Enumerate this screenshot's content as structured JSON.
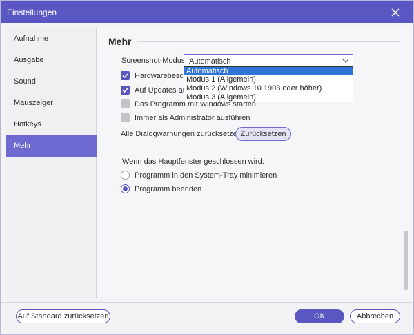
{
  "window": {
    "title": "Einstellungen"
  },
  "sidebar": {
    "items": [
      {
        "label": "Aufnahme"
      },
      {
        "label": "Ausgabe"
      },
      {
        "label": "Sound"
      },
      {
        "label": "Mauszeiger"
      },
      {
        "label": "Hotkeys"
      },
      {
        "label": "Mehr",
        "active": true
      }
    ]
  },
  "main": {
    "section_title": "Mehr",
    "screenshot_mode": {
      "label": "Screenshot-Modus:",
      "value": "Automatisch",
      "options": [
        "Automatisch",
        "Modus 1 (Allgemein)",
        "Modus 2 (Windows 10 1903 oder höher)",
        "Modus 3 (Allgemein)"
      ]
    },
    "checkboxes": [
      {
        "label": "Hardwarebeschl",
        "checked": true
      },
      {
        "label": "Auf Updates aut",
        "checked": true
      },
      {
        "label": "Das Programm mit Windows starten",
        "checked": false
      },
      {
        "label": "Immer als Administrator ausführen",
        "checked": false
      }
    ],
    "dialog_warnings": {
      "label": "Alle Dialogwarnungen zurücksetzen:",
      "button": "Zurücksetzen"
    },
    "close_behavior": {
      "label": "Wenn das Hauptfenster geschlossen wird:",
      "options": [
        {
          "label": "Programm in den System-Tray minimieren",
          "selected": false
        },
        {
          "label": "Programm beenden",
          "selected": true
        }
      ]
    }
  },
  "footer": {
    "reset_defaults": "Auf Standard zurücksetzen",
    "ok": "OK",
    "cancel": "Abbrechen"
  },
  "colors": {
    "accent": "#5b57c2",
    "sidebar_active": "#6e6ad2",
    "dropdown_highlight": "#2f74d6"
  }
}
